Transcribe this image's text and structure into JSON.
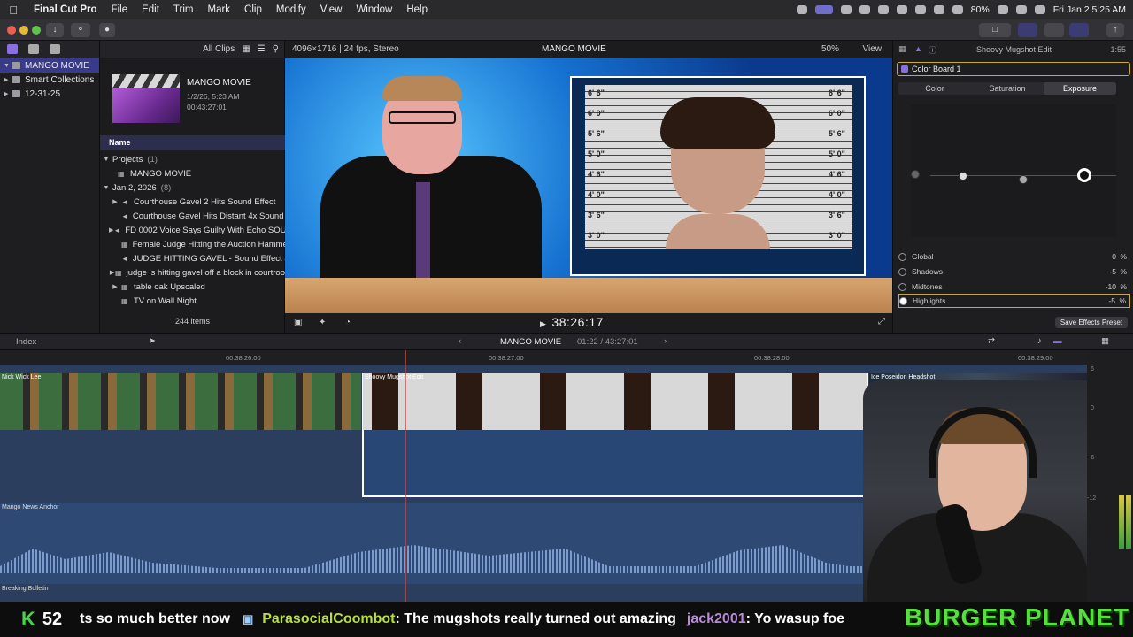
{
  "menubar": {
    "app": "Final Cut Pro",
    "items": [
      "File",
      "Edit",
      "Trim",
      "Mark",
      "Clip",
      "Modify",
      "View",
      "Window",
      "Help"
    ],
    "battery": "80%",
    "datetime": "Fri Jan 2  5:25 AM"
  },
  "libraries": {
    "rows": [
      {
        "label": "MANGO MOVIE",
        "selected": true
      },
      {
        "label": "Smart Collections"
      },
      {
        "label": "12-31-25"
      }
    ]
  },
  "browser": {
    "filter": "All Clips",
    "event_title": "MANGO MOVIE",
    "event_date": "1/2/26, 5:23 AM",
    "event_duration": "00:43:27:01",
    "column_header": "Name",
    "groups": [
      {
        "label": "Projects",
        "count": "(1)",
        "items": [
          "MANGO MOVIE"
        ]
      },
      {
        "label": "Jan 2, 2026",
        "count": "(8)",
        "items": [
          "Courthouse Gavel 2 Hits Sound Effect",
          "Courthouse Gavel Hits Distant 4x Sound Ef",
          "FD 0002  Voice Says Guilty With Echo SOU",
          "Female Judge Hitting the Auction Hammer",
          "JUDGE HITTING GAVEL - Sound Effect & V",
          "judge is hitting gavel off a block in courtroo",
          "table oak Upscaled",
          "TV on Wall Night"
        ]
      }
    ],
    "item_count": "244 items"
  },
  "viewer": {
    "format": "4096×1716 | 24 fps, Stereo",
    "title": "MANGO MOVIE",
    "zoom": "50%",
    "view_menu": "View",
    "timecode": "38:26:17",
    "height_marks": [
      "6' 6\"",
      "6' 0\"",
      "5' 6\"",
      "5' 0\"",
      "4' 6\"",
      "4' 0\"",
      "3' 6\"",
      "3' 0\""
    ]
  },
  "inspector": {
    "title": "Shoovy Mugshot Edit",
    "duration": "1:55",
    "color_board": "Color Board 1",
    "tabs": [
      "Color",
      "Saturation",
      "Exposure"
    ],
    "active_tab": "Exposure",
    "params": [
      {
        "label": "Global",
        "value": "0",
        "unit": "%"
      },
      {
        "label": "Shadows",
        "value": "-5",
        "unit": "%"
      },
      {
        "label": "Midtones",
        "value": "-10",
        "unit": "%"
      },
      {
        "label": "Highlights",
        "value": "-5",
        "unit": "%"
      }
    ],
    "save_preset": "Save Effects Preset"
  },
  "timeline": {
    "index": "Index",
    "project": "MANGO MOVIE",
    "position": "01:22 / 43:27:01",
    "ruler": [
      "00:38:26:00",
      "00:38:27:00",
      "00:38:28:00",
      "00:38:29:00"
    ],
    "clips": [
      "Nick Wick Lee",
      "Shoovy Mugshot Edit",
      "Ice Poseidon Headshot"
    ],
    "audio_clip": "Mango News Anchor",
    "bottom_clip": "Breaking Bulletin",
    "meter_labels": [
      "6",
      "0",
      "-6",
      "-12"
    ]
  },
  "chat": {
    "k_label": "K",
    "k_count": "52",
    "msg_prefix": "ts so much better now",
    "user1": "ParasocialCoombot",
    "msg1": ": The mugshots really turned out amazing",
    "user2": "jack2001",
    "msg2": ": Yo wasup foe",
    "brand": "BURGER PLANET"
  }
}
